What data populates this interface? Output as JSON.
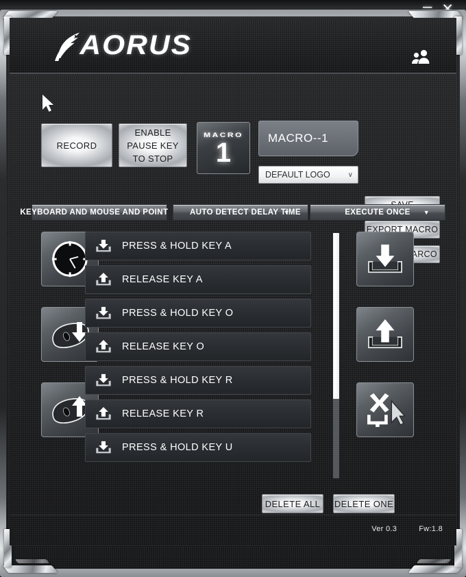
{
  "window": {
    "minimize_label": "–",
    "close_label": "✕"
  },
  "header": {
    "brand": "AORUS",
    "falcon_icon": "aorus-falcon-icon",
    "profile_icon": "users-icon"
  },
  "toolbar": {
    "record_label": "RECORD",
    "pause_label_line1": "ENABLE",
    "pause_label_line2": "PAUSE KEY",
    "pause_label_line3": "TO STOP",
    "macro_badge_word": "MACRO",
    "macro_badge_number": "1",
    "macro_name_value": "MACRO--1",
    "macro_name_placeholder": "MACRO--1",
    "logo_select_value": "DEFAULT LOGO",
    "logo_select_chevron": "∨",
    "save_label": "SAVE",
    "export_label": "EXPORT MACRO",
    "import_label": "IMPORT MARCO"
  },
  "filters": {
    "arrow": "▼",
    "device_filter": "KEYBOARD AND MOUSE AND POINT",
    "delay_mode": "AUTO DETECT DELAY TIME",
    "execute_mode": "EXECUTE ONCE"
  },
  "left_tools": [
    {
      "name": "delay-clock-tool",
      "icon": "clock-icon"
    },
    {
      "name": "mouse-press-tool",
      "icon": "mouse-down-arrow-icon"
    },
    {
      "name": "mouse-release-tool",
      "icon": "mouse-up-arrow-icon"
    }
  ],
  "right_tools": [
    {
      "name": "key-press-tool",
      "icon": "key-down-arrow-icon"
    },
    {
      "name": "key-release-tool",
      "icon": "key-up-arrow-icon"
    },
    {
      "name": "point-click-tool",
      "icon": "cursor-cross-icon"
    }
  ],
  "macro_list": [
    {
      "action": "press",
      "label": "PRESS & HOLD KEY A",
      "icon": "key-down-arrow-icon"
    },
    {
      "action": "release",
      "label": "RELEASE KEY A",
      "icon": "key-up-arrow-icon"
    },
    {
      "action": "press",
      "label": "PRESS & HOLD KEY O",
      "icon": "key-down-arrow-icon"
    },
    {
      "action": "release",
      "label": "RELEASE KEY O",
      "icon": "key-up-arrow-icon"
    },
    {
      "action": "press",
      "label": "PRESS & HOLD KEY R",
      "icon": "key-down-arrow-icon"
    },
    {
      "action": "release",
      "label": "RELEASE KEY R",
      "icon": "key-up-arrow-icon"
    },
    {
      "action": "press",
      "label": "PRESS & HOLD KEY U",
      "icon": "key-down-arrow-icon"
    }
  ],
  "footer": {
    "delete_all_label": "DELETE ALL",
    "delete_one_label": "DELETE ONE",
    "version": "Ver 0.3",
    "firmware": "Fw:1.8"
  },
  "colors": {
    "background": "#141516",
    "panel": "#1b1c1e",
    "silver": "#dfe2e5",
    "accent_text": "#ffffff",
    "list_item": "#2b2e32",
    "dropdown": "#4a4e53"
  }
}
